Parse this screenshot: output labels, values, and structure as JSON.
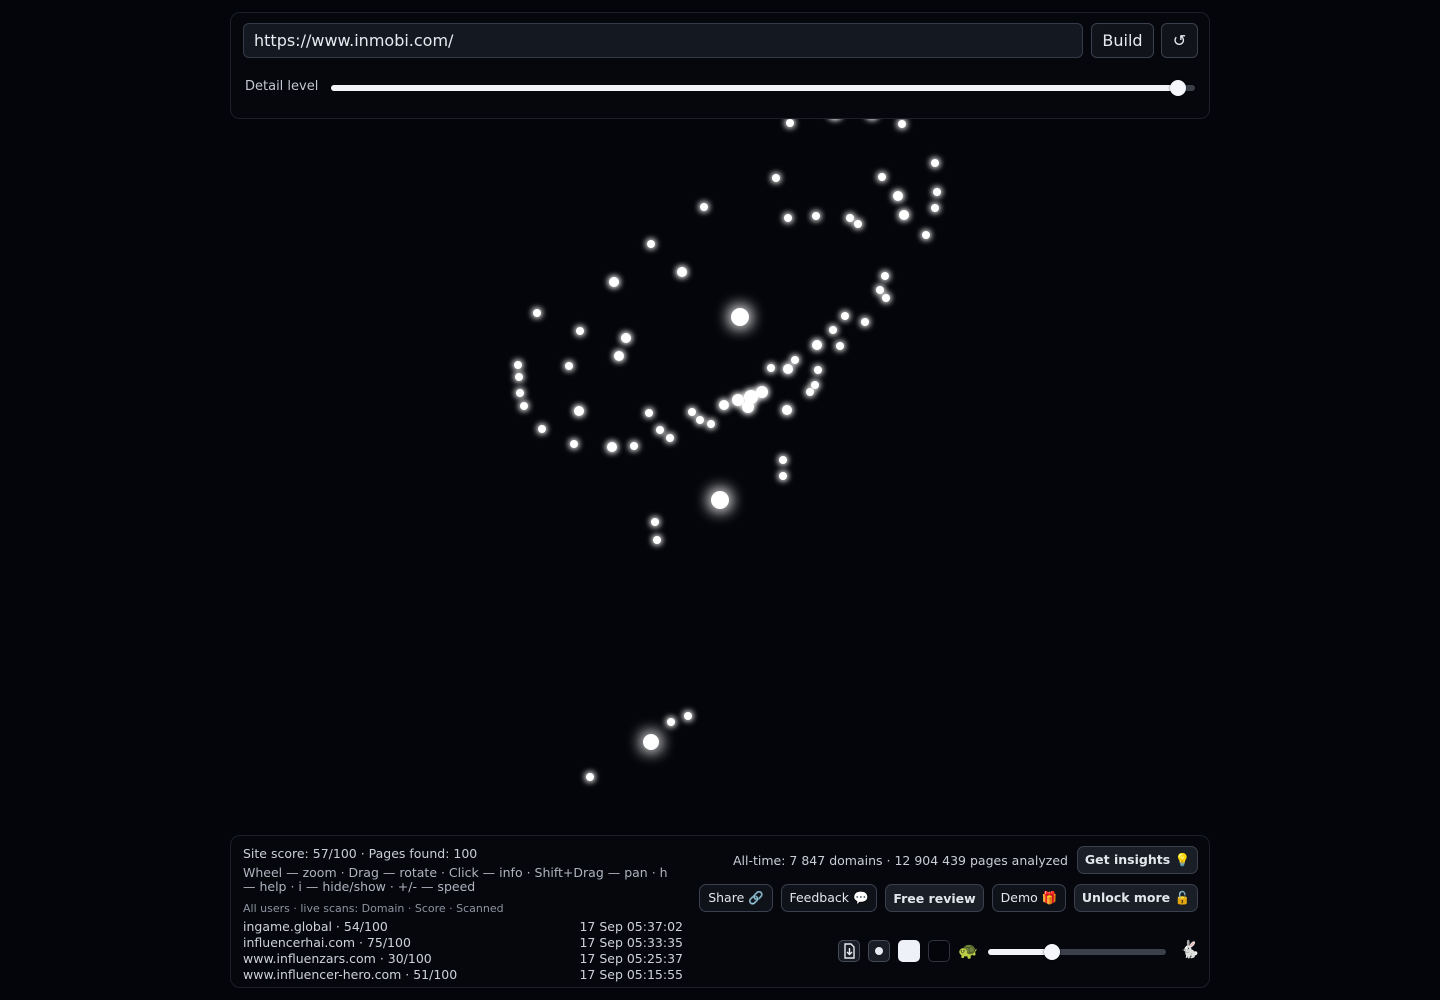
{
  "toolbar": {
    "url_value": "https://www.inmobi.com/",
    "build_label": "Build",
    "reset_label": "↺",
    "detail_label": "Detail level",
    "detail_level": 0.98
  },
  "stats": {
    "site_line": "Site score: 57/100 · Pages found: 100",
    "help_line": "Wheel — zoom · Drag — rotate · Click — info · Shift+Drag — pan · h — help · i — hide/show · +/- — speed",
    "alltime_line": "All-time: 7 847 domains · 12 904 439 pages analyzed"
  },
  "feed": {
    "header": "All users · live scans: Domain · Score · Scanned",
    "rows": [
      {
        "domain": "ingame.global · 54/100",
        "time": "17 Sep 05:37:02"
      },
      {
        "domain": "influencerhai.com · 75/100",
        "time": "17 Sep 05:33:35"
      },
      {
        "domain": "www.influenzars.com · 30/100",
        "time": "17 Sep 05:25:37"
      },
      {
        "domain": "www.influencer-hero.com · 51/100",
        "time": "17 Sep 05:15:55"
      }
    ]
  },
  "actions": {
    "insights": "Get insights 💡",
    "share": "Share 🔗",
    "feedback": "Feedback 💬",
    "review": "Free review",
    "demo": "Demo 🎁",
    "unlock": "Unlock more 🔓"
  },
  "controls": {
    "turtle_icon": "🐢",
    "rabbit_icon": "🐇",
    "speed": 0.36
  },
  "graph": {
    "node_color": "#ffffff",
    "background": "#04050a"
  }
}
